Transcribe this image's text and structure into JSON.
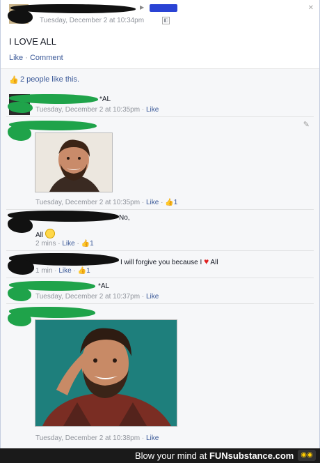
{
  "post": {
    "timestamp": "Tuesday, December 2 at 10:34pm",
    "text": "I LOVE ALL",
    "like_label": "Like",
    "dot": "·",
    "comment_label": "Comment",
    "likes_summary": "2 people like this."
  },
  "comments": [
    {
      "text": "*AL",
      "time": "Tuesday, December 2 at 10:35pm",
      "like": "Like"
    },
    {
      "text": "",
      "time": "Tuesday, December 2 at 10:35pm",
      "like": "Like",
      "like_count": "1"
    },
    {
      "text": "No,",
      "text2": "All",
      "time": "2 mins",
      "like": "Like",
      "like_count": "1"
    },
    {
      "text": "I will forgive you because I",
      "text_after": "All",
      "time": "1 min",
      "like": "Like",
      "like_count": "1"
    },
    {
      "text": "*AL",
      "time": "Tuesday, December 2 at 10:37pm",
      "like": "Like"
    },
    {
      "text": "",
      "time": "Tuesday, December 2 at 10:38pm",
      "like": "Like"
    }
  ],
  "watermark": {
    "text": "Blow your mind at",
    "brand": "FUNsubstance.com"
  },
  "colors": {
    "link": "#3b5998",
    "meta": "#90949c",
    "comments_bg": "#f6f7f9",
    "heart": "#e02020"
  },
  "icons": [
    "thumbs-up-icon",
    "pencil-icon",
    "smile-emoji-icon",
    "heart-icon",
    "privacy-icon"
  ]
}
